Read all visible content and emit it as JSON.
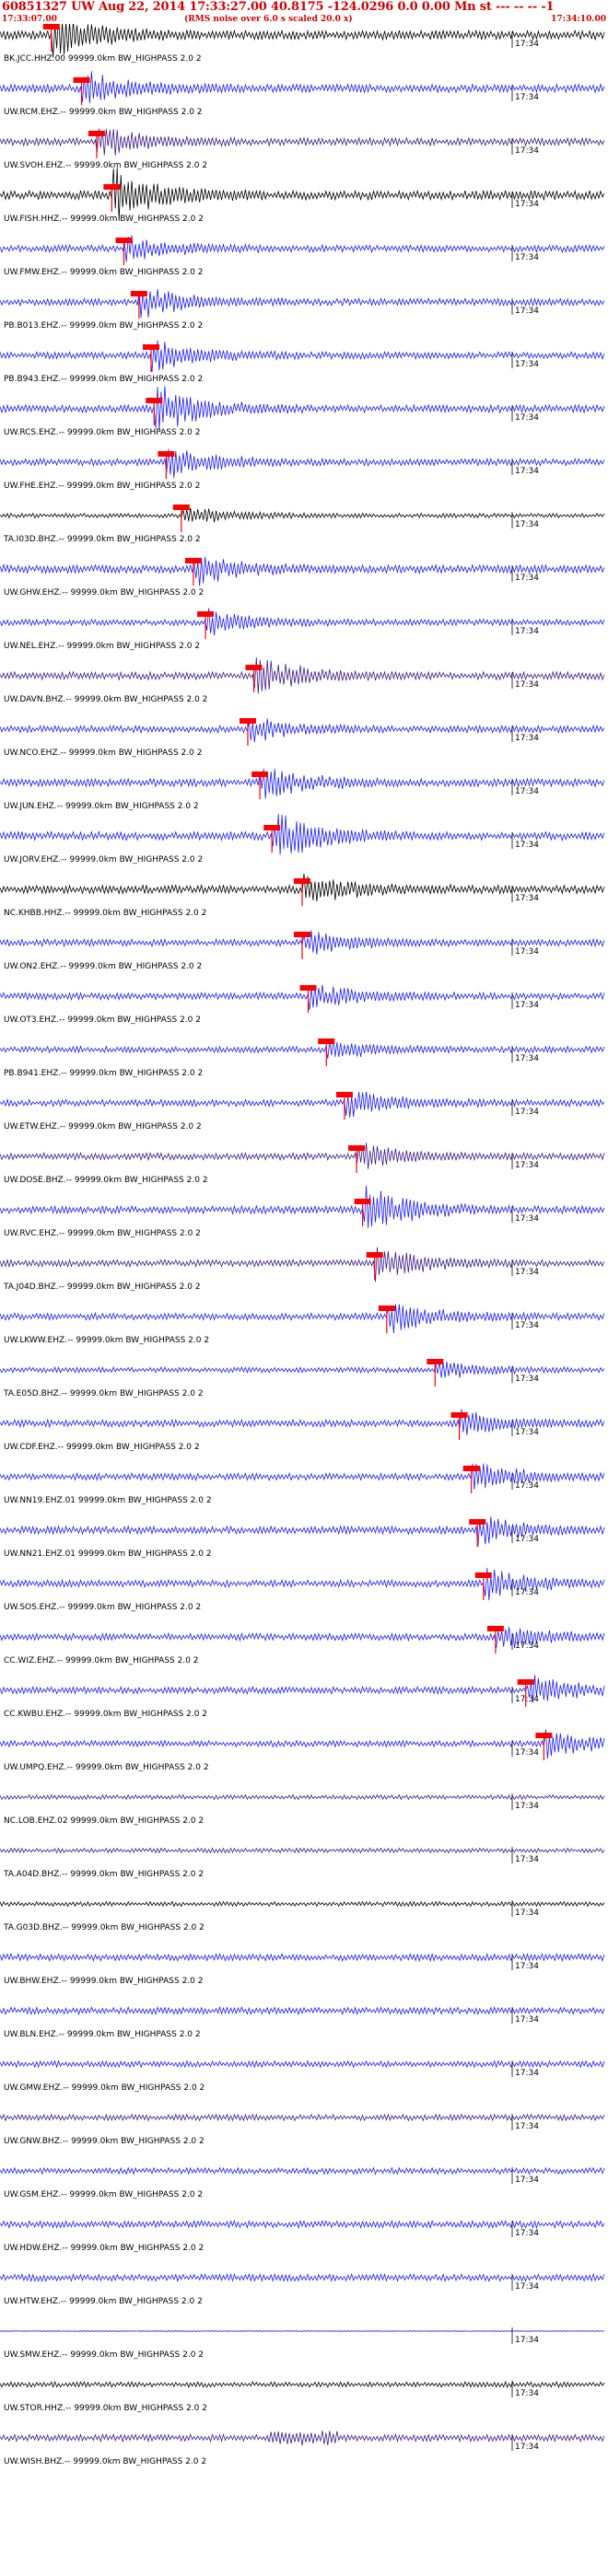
{
  "header": {
    "title": "60851327 UW Aug 22, 2014 17:33:27.00   40.8175 -124.0296  0.0 0.00 Mn st --- -- --   -1",
    "start_time": "17:33:07.00",
    "note": "(RMS noise over 6.0 s scaled 20.0 x)",
    "end_time": "17:34:10.00"
  },
  "chart_data": {
    "type": "line",
    "title": "60851327 UW Aug 22, 2014 17:33:27.00   40.8175 -124.0296  0.0 0.00 Mn st --- -- --   -1",
    "x_range": [
      "17:33:07.00",
      "17:34:10.00"
    ],
    "minute_tick_label": "17:34",
    "grid": false,
    "colors": {
      "trace_blue": "#1a1aff",
      "trace_black": "#000000",
      "trace_purple": "#3a1a8a",
      "pick": "#ff0000",
      "header": "#d00000"
    },
    "traces": [
      {
        "label": "BK.JCC.HHZ.00 99999.0km BW_HIGHPASS  2.0  2",
        "color": "#000000",
        "arrival": 0.085,
        "amp": 0.6,
        "burst": 0.9
      },
      {
        "label": "UW.RCM.EHZ.-- 99999.0km BW_HIGHPASS  2.0  2",
        "color": "#1a1aff",
        "arrival": 0.135,
        "amp": 0.55,
        "burst": 0.7
      },
      {
        "label": "UW.SVOH.EHZ.-- 99999.0km BW_HIGHPASS  2.0  2",
        "color": "#3a1a8a",
        "arrival": 0.16,
        "amp": 0.5,
        "burst": 0.6
      },
      {
        "label": "UW.FISH.HHZ.-- 99999.0km BW_HIGHPASS  2.0  2",
        "color": "#000000",
        "arrival": 0.185,
        "amp": 0.6,
        "burst": 1.0
      },
      {
        "label": "UW.FMW.EHZ.-- 99999.0km BW_HIGHPASS  2.0  2",
        "color": "#1a1aff",
        "arrival": 0.205,
        "amp": 0.45,
        "burst": 0.5
      },
      {
        "label": "PB.B013.EHZ.-- 99999.0km BW_HIGHPASS  2.0  2",
        "color": "#1a1aff",
        "arrival": 0.23,
        "amp": 0.45,
        "burst": 0.6
      },
      {
        "label": "PB.B943.EHZ.-- 99999.0km BW_HIGHPASS  2.0  2",
        "color": "#1a1aff",
        "arrival": 0.25,
        "amp": 0.45,
        "burst": 0.6
      },
      {
        "label": "UW.RCS.EHZ.-- 99999.0km BW_HIGHPASS  2.0  2",
        "color": "#1a1aff",
        "arrival": 0.255,
        "amp": 0.5,
        "burst": 1.0
      },
      {
        "label": "UW.FHE.EHZ.-- 99999.0km BW_HIGHPASS  2.0  2",
        "color": "#1a1aff",
        "arrival": 0.275,
        "amp": 0.45,
        "burst": 0.6
      },
      {
        "label": "TA.I03D.BHZ.-- 99999.0km BW_HIGHPASS  2.0  2",
        "color": "#000000",
        "arrival": 0.3,
        "amp": 0.3,
        "burst": 0.4
      },
      {
        "label": "UW.GHW.EHZ.-- 99999.0km BW_HIGHPASS  2.0  2",
        "color": "#1a1aff",
        "arrival": 0.32,
        "amp": 0.55,
        "burst": 0.6
      },
      {
        "label": "UW.NEL.EHZ.-- 99999.0km BW_HIGHPASS  2.0  2",
        "color": "#1a1aff",
        "arrival": 0.34,
        "amp": 0.4,
        "burst": 0.5
      },
      {
        "label": "UW.DAVN.BHZ.-- 99999.0km BW_HIGHPASS  2.0  2",
        "color": "#3a1a8a",
        "arrival": 0.42,
        "amp": 0.5,
        "burst": 0.8
      },
      {
        "label": "UW.NCO.EHZ.-- 99999.0km BW_HIGHPASS  2.0  2",
        "color": "#1a1aff",
        "arrival": 0.41,
        "amp": 0.45,
        "burst": 0.5
      },
      {
        "label": "UW.JUN.EHZ.-- 99999.0km BW_HIGHPASS  2.0  2",
        "color": "#1a1aff",
        "arrival": 0.43,
        "amp": 0.5,
        "burst": 0.7
      },
      {
        "label": "UW.JORV.EHZ.-- 99999.0km BW_HIGHPASS  2.0  2",
        "color": "#1a1aff",
        "arrival": 0.45,
        "amp": 0.55,
        "burst": 1.0
      },
      {
        "label": "NC.KHBB.HHZ.-- 99999.0km BW_HIGHPASS  2.0  2",
        "color": "#000000",
        "arrival": 0.5,
        "amp": 0.55,
        "burst": 0.7
      },
      {
        "label": "UW.ON2.EHZ.-- 99999.0km BW_HIGHPASS  2.0  2",
        "color": "#1a1aff",
        "arrival": 0.5,
        "amp": 0.45,
        "burst": 0.5
      },
      {
        "label": "UW.OT3.EHZ.-- 99999.0km BW_HIGHPASS  2.0  2",
        "color": "#1a1aff",
        "arrival": 0.51,
        "amp": 0.45,
        "burst": 0.5
      },
      {
        "label": "PB.B941.EHZ.-- 99999.0km BW_HIGHPASS  2.0  2",
        "color": "#1a1aff",
        "arrival": 0.54,
        "amp": 0.4,
        "burst": 0.4
      },
      {
        "label": "UW.ETW.EHZ.-- 99999.0km BW_HIGHPASS  2.0  2",
        "color": "#1a1aff",
        "arrival": 0.57,
        "amp": 0.45,
        "burst": 0.6
      },
      {
        "label": "UW.DOSE.BHZ.-- 99999.0km BW_HIGHPASS  2.0  2",
        "color": "#3a1a8a",
        "arrival": 0.59,
        "amp": 0.45,
        "burst": 0.5
      },
      {
        "label": "UW.RVC.EHZ.-- 99999.0km BW_HIGHPASS  2.0  2",
        "color": "#1a1aff",
        "arrival": 0.6,
        "amp": 0.5,
        "burst": 1.0
      },
      {
        "label": "TA.J04D.BHZ.-- 99999.0km BW_HIGHPASS  2.0  2",
        "color": "#3a1a8a",
        "arrival": 0.62,
        "amp": 0.45,
        "burst": 0.7
      },
      {
        "label": "UW.LKWW.EHZ.-- 99999.0km BW_HIGHPASS  2.0  2",
        "color": "#1a1aff",
        "arrival": 0.64,
        "amp": 0.45,
        "burst": 0.7
      },
      {
        "label": "TA.E05D.BHZ.-- 99999.0km BW_HIGHPASS  2.0  2",
        "color": "#1a1aff",
        "arrival": 0.72,
        "amp": 0.35,
        "burst": 0.4
      },
      {
        "label": "UW.CDF.EHZ.-- 99999.0km BW_HIGHPASS  2.0  2",
        "color": "#1a1aff",
        "arrival": 0.76,
        "amp": 0.45,
        "burst": 0.5
      },
      {
        "label": "UW.NN19.EHZ.01 99999.0km BW_HIGHPASS  2.0  2",
        "color": "#1a1aff",
        "arrival": 0.78,
        "amp": 0.45,
        "burst": 0.6
      },
      {
        "label": "UW.NN21.EHZ.01 99999.0km BW_HIGHPASS  2.0  2",
        "color": "#1a1aff",
        "arrival": 0.79,
        "amp": 0.5,
        "burst": 0.6
      },
      {
        "label": "UW.SOS.EHZ.-- 99999.0km BW_HIGHPASS  2.0  2",
        "color": "#1a1aff",
        "arrival": 0.8,
        "amp": 0.45,
        "burst": 0.6
      },
      {
        "label": "CC.WIZ.EHZ.-- 99999.0km BW_HIGHPASS  2.0  2",
        "color": "#1a1aff",
        "arrival": 0.82,
        "amp": 0.45,
        "burst": 0.5
      },
      {
        "label": "CC.KWBU.EHZ.-- 99999.0km BW_HIGHPASS  2.0  2",
        "color": "#1a1aff",
        "arrival": 0.87,
        "amp": 0.45,
        "burst": 0.6
      },
      {
        "label": "UW.UMPQ.EHZ.-- 99999.0km BW_HIGHPASS  2.0  2",
        "color": "#1a1aff",
        "arrival": 0.9,
        "amp": 0.4,
        "burst": 0.6
      },
      {
        "label": "NC.LOB.EHZ.02 99999.0km BW_HIGHPASS  2.0  2",
        "color": "#3a1a8a",
        "arrival": null,
        "amp": 0.3,
        "burst": 0
      },
      {
        "label": "TA.A04D.BHZ.-- 99999.0km BW_HIGHPASS  2.0  2",
        "color": "#3a1a8a",
        "arrival": null,
        "amp": 0.3,
        "burst": 0
      },
      {
        "label": "TA.G03D.BHZ.-- 99999.0km BW_HIGHPASS  2.0  2",
        "color": "#000000",
        "arrival": null,
        "amp": 0.3,
        "burst": 0
      },
      {
        "label": "UW.BHW.EHZ.-- 99999.0km BW_HIGHPASS  2.0  2",
        "color": "#1a1aff",
        "arrival": null,
        "amp": 0.45,
        "burst": 0
      },
      {
        "label": "UW.BLN.EHZ.-- 99999.0km BW_HIGHPASS  2.0  2",
        "color": "#1a1aff",
        "arrival": null,
        "amp": 0.45,
        "burst": 0
      },
      {
        "label": "UW.GMW.EHZ.-- 99999.0km BW_HIGHPASS  2.0  2",
        "color": "#1a1aff",
        "arrival": null,
        "amp": 0.4,
        "burst": 0
      },
      {
        "label": "UW.GNW.BHZ.-- 99999.0km BW_HIGHPASS  2.0  2",
        "color": "#3a1a8a",
        "arrival": null,
        "amp": 0.4,
        "burst": 0
      },
      {
        "label": "UW.GSM.EHZ.-- 99999.0km BW_HIGHPASS  2.0  2",
        "color": "#1a1aff",
        "arrival": null,
        "amp": 0.4,
        "burst": 0
      },
      {
        "label": "UW.HDW.EHZ.-- 99999.0km BW_HIGHPASS  2.0  2",
        "color": "#1a1aff",
        "arrival": null,
        "amp": 0.45,
        "burst": 0
      },
      {
        "label": "UW.HTW.EHZ.-- 99999.0km BW_HIGHPASS  2.0  2",
        "color": "#1a1aff",
        "arrival": null,
        "amp": 0.45,
        "burst": 0
      },
      {
        "label": "UW.SMW.EHZ.-- 99999.0km BW_HIGHPASS  2.0  2",
        "color": "#1a1aff",
        "arrival": null,
        "amp": 0.04,
        "burst": 0
      },
      {
        "label": "UW.STOR.HHZ.-- 99999.0km BW_HIGHPASS  2.0  2",
        "color": "#000000",
        "arrival": null,
        "amp": 0.35,
        "burst": 0
      },
      {
        "label": "UW.WISH.BHZ.-- 99999.0km BW_HIGHPASS  2.0  2",
        "color": "#3a1a8a",
        "arrival": null,
        "amp": 0.45,
        "burst": 0.4
      }
    ]
  }
}
